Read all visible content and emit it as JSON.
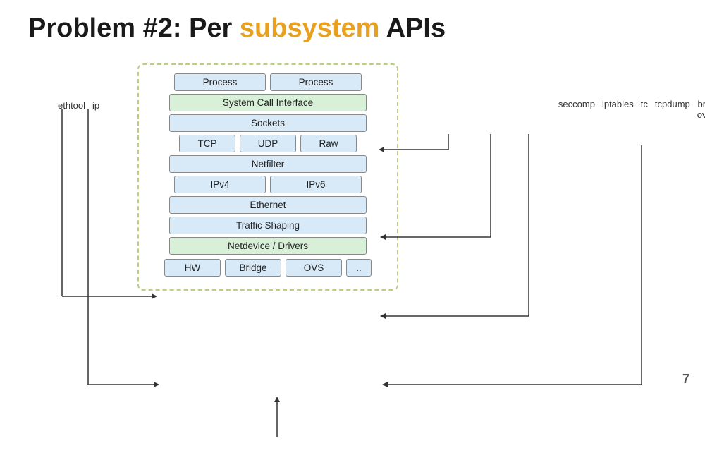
{
  "title": {
    "prefix": "Problem #2: Per ",
    "highlight": "subsystem",
    "suffix": " APIs"
  },
  "left_labels": [
    "ethtool",
    "ip"
  ],
  "right_labels": [
    "seccomp",
    "iptables",
    "tc",
    "tcpdump",
    "brctl /\novsctl"
  ],
  "diagram": {
    "rows": [
      {
        "type": "double",
        "boxes": [
          {
            "label": "Process",
            "style": "blue"
          },
          {
            "label": "Process",
            "style": "blue"
          }
        ]
      },
      {
        "type": "single",
        "boxes": [
          {
            "label": "System Call Interface",
            "style": "green",
            "wide": true
          }
        ]
      },
      {
        "type": "single",
        "boxes": [
          {
            "label": "Sockets",
            "style": "blue",
            "wide": true
          }
        ]
      },
      {
        "type": "triple",
        "boxes": [
          {
            "label": "TCP",
            "style": "blue"
          },
          {
            "label": "UDP",
            "style": "blue"
          },
          {
            "label": "Raw",
            "style": "blue"
          }
        ]
      },
      {
        "type": "single",
        "boxes": [
          {
            "label": "Netfilter",
            "style": "blue",
            "wide": true
          }
        ]
      },
      {
        "type": "double",
        "boxes": [
          {
            "label": "IPv4",
            "style": "blue"
          },
          {
            "label": "IPv6",
            "style": "blue"
          }
        ]
      },
      {
        "type": "single",
        "boxes": [
          {
            "label": "Ethernet",
            "style": "blue",
            "wide": true
          }
        ]
      },
      {
        "type": "single",
        "boxes": [
          {
            "label": "Traffic Shaping",
            "style": "blue",
            "wide": true
          }
        ]
      },
      {
        "type": "single",
        "boxes": [
          {
            "label": "Netdevice / Drivers",
            "style": "green",
            "wide": true
          }
        ]
      },
      {
        "type": "quad",
        "boxes": [
          {
            "label": "HW",
            "style": "blue"
          },
          {
            "label": "Bridge",
            "style": "blue"
          },
          {
            "label": "OVS",
            "style": "blue"
          },
          {
            "label": "..",
            "style": "blue"
          }
        ]
      }
    ]
  },
  "page_number": "7"
}
